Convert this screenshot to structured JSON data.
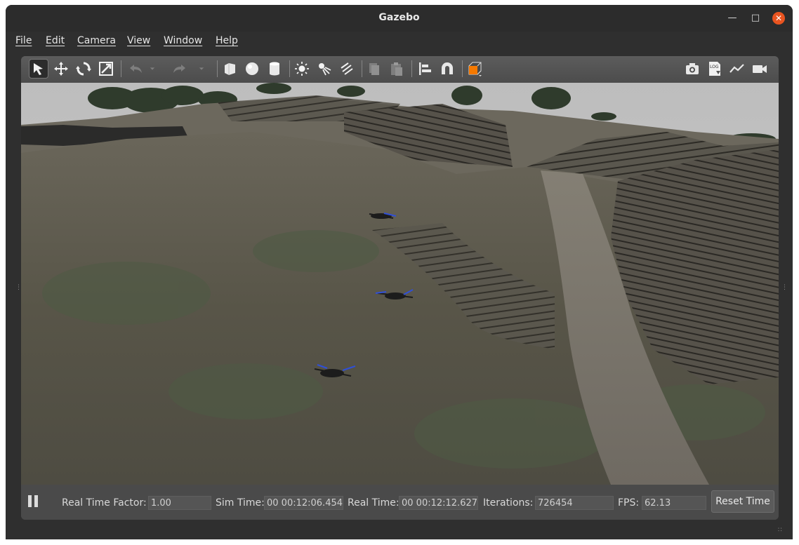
{
  "window": {
    "title": "Gazebo"
  },
  "menubar": {
    "items": [
      {
        "label": "File"
      },
      {
        "label": "Edit"
      },
      {
        "label": "Camera"
      },
      {
        "label": "View"
      },
      {
        "label": "Window"
      },
      {
        "label": "Help"
      }
    ]
  },
  "toolbar": {
    "left_icons": [
      "select-arrow-icon",
      "translate-icon",
      "rotate-icon",
      "scale-icon",
      "undo-icon",
      "undo-dropdown-icon",
      "redo-icon",
      "redo-dropdown-icon",
      "box-shape-icon",
      "sphere-shape-icon",
      "cylinder-shape-icon",
      "point-light-icon",
      "spot-light-icon",
      "directional-light-icon",
      "copy-icon",
      "paste-icon",
      "align-icon",
      "magnet-snap-icon",
      "view-angle-icon"
    ],
    "right_icons": [
      "screenshot-camera-icon",
      "log-icon",
      "plot-icon",
      "video-record-icon"
    ],
    "log_badge": "LOG",
    "accent_color": "#f57900"
  },
  "status": {
    "real_time_factor_label": "Real Time Factor:",
    "real_time_factor_value": "1.00",
    "sim_time_label": "Sim Time:",
    "sim_time_value": "00 00:12:06.454",
    "real_time_label": "Real Time:",
    "real_time_value": "00 00:12:12.627",
    "iterations_label": "Iterations:",
    "iterations_value": "726454",
    "fps_label": "FPS:",
    "fps_value": "62.13",
    "reset_time_label": "Reset Time"
  },
  "scene": {
    "drone_count": 3,
    "sky_color": "#c4c4c4",
    "terrain_color": "#5e5a4c",
    "rotor_color": "#2f4fd8"
  }
}
